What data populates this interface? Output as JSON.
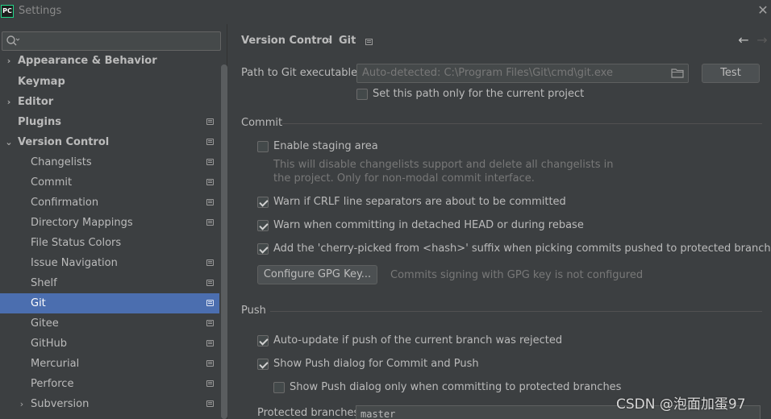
{
  "window": {
    "title": "Settings",
    "app_icon_text": "PC"
  },
  "sidebar": {
    "search_placeholder": "",
    "items": [
      {
        "label": "Appearance & Behavior",
        "bold": true,
        "arrow": "›",
        "indent": 0,
        "icon": false
      },
      {
        "label": "Keymap",
        "bold": true,
        "arrow": "",
        "indent": 0,
        "icon": false
      },
      {
        "label": "Editor",
        "bold": true,
        "arrow": "›",
        "indent": 0,
        "icon": false
      },
      {
        "label": "Plugins",
        "bold": true,
        "arrow": "",
        "indent": 0,
        "icon": true
      },
      {
        "label": "Version Control",
        "bold": true,
        "arrow": "⌄",
        "indent": 0,
        "icon": true
      },
      {
        "label": "Changelists",
        "bold": false,
        "arrow": "",
        "indent": 1,
        "icon": true
      },
      {
        "label": "Commit",
        "bold": false,
        "arrow": "",
        "indent": 1,
        "icon": true
      },
      {
        "label": "Confirmation",
        "bold": false,
        "arrow": "",
        "indent": 1,
        "icon": true
      },
      {
        "label": "Directory Mappings",
        "bold": false,
        "arrow": "",
        "indent": 1,
        "icon": true
      },
      {
        "label": "File Status Colors",
        "bold": false,
        "arrow": "",
        "indent": 1,
        "icon": false
      },
      {
        "label": "Issue Navigation",
        "bold": false,
        "arrow": "",
        "indent": 1,
        "icon": true
      },
      {
        "label": "Shelf",
        "bold": false,
        "arrow": "",
        "indent": 1,
        "icon": true
      },
      {
        "label": "Git",
        "bold": false,
        "arrow": "",
        "indent": 1,
        "icon": true,
        "selected": true
      },
      {
        "label": "Gitee",
        "bold": false,
        "arrow": "",
        "indent": 1,
        "icon": true
      },
      {
        "label": "GitHub",
        "bold": false,
        "arrow": "",
        "indent": 1,
        "icon": true
      },
      {
        "label": "Mercurial",
        "bold": false,
        "arrow": "",
        "indent": 1,
        "icon": true
      },
      {
        "label": "Perforce",
        "bold": false,
        "arrow": "",
        "indent": 1,
        "icon": true
      },
      {
        "label": "Subversion",
        "bold": false,
        "arrow": "›",
        "indent": 1,
        "icon": true
      }
    ]
  },
  "breadcrumb": {
    "parent": "Version Control",
    "separator": "›",
    "current": "Git"
  },
  "git_path": {
    "label": "Path to Git executable:",
    "placeholder": "Auto-detected: C:\\Program Files\\Git\\cmd\\git.exe",
    "test_button": "Test",
    "current_project_only": {
      "label": "Set this path only for the current project",
      "checked": false
    }
  },
  "commit": {
    "title": "Commit",
    "enable_staging": {
      "label": "Enable staging area",
      "checked": false
    },
    "staging_hint_line1": "This will disable changelists support and delete all changelists in",
    "staging_hint_line2": "the project. Only for non-modal commit interface.",
    "warn_crlf": {
      "label": "Warn if CRLF line separators are about to be committed",
      "checked": true
    },
    "warn_detached": {
      "label": "Warn when committing in detached HEAD or during rebase",
      "checked": true
    },
    "cherry_pick": {
      "label": "Add the 'cherry-picked from <hash>' suffix when picking commits pushed to protected branches",
      "checked": true
    },
    "gpg_button": "Configure GPG Key...",
    "gpg_status": "Commits signing with GPG key is not configured"
  },
  "push": {
    "title": "Push",
    "auto_update": {
      "label": "Auto-update if push of the current branch was rejected",
      "checked": true
    },
    "show_push_dialog": {
      "label": "Show Push dialog for Commit and Push",
      "checked": true
    },
    "show_push_protected": {
      "label": "Show Push dialog only when committing to protected branches",
      "checked": false
    },
    "protected_label": "Protected branches:",
    "protected_value": "master"
  },
  "watermark": "CSDN @泡面加蛋97",
  "colors": {
    "selection": "#4b6eaf",
    "background": "#3c3f41"
  }
}
